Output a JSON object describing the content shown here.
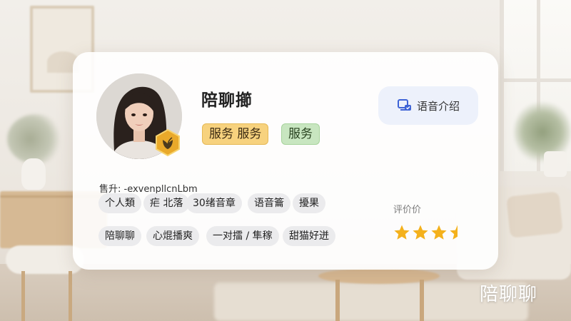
{
  "profile": {
    "name": "陪聊擳",
    "tags": [
      "服务 服务",
      "服务"
    ],
    "voice_button_label": "语音介绍",
    "info_line": "售升: ‑exvenpllcnLbm"
  },
  "chips_row1": [
    "个人類",
    "疟 北落",
    "30绪音章",
    "语音籥",
    "擾果"
  ],
  "chips_row2": [
    "陪聊聊",
    "心焜播爽",
    "一对擂 / 隼稼",
    "甜猫好迸"
  ],
  "rating": {
    "label": "评价价",
    "value": 3.5,
    "max": 5,
    "star_color": "#f4b11c"
  },
  "watermark": "陪聊聊",
  "icons": {
    "voice": "voice-intro-icon",
    "medal": "medal-badge-icon"
  }
}
